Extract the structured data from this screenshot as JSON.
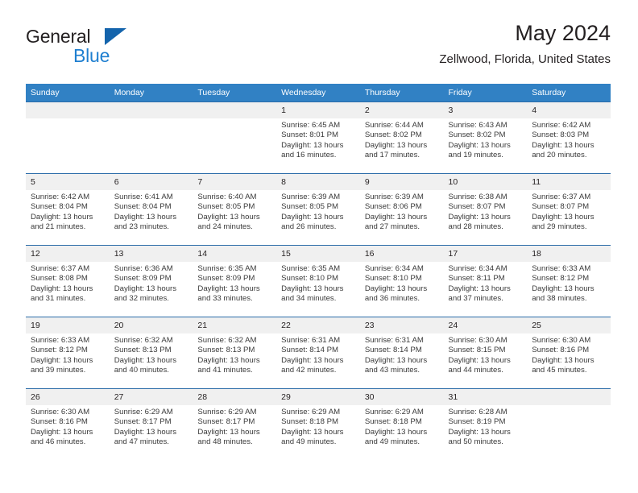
{
  "brand": {
    "name_part1": "General",
    "name_part2": "Blue",
    "logo_icon": "triangle-icon"
  },
  "header": {
    "title": "May 2024",
    "subtitle": "Zellwood, Florida, United States"
  },
  "colors": {
    "header_bar": "#3181c4",
    "daynum_band": "#f0f0f0",
    "row_border": "#2a6ba8",
    "brand_blue": "#1f7fd0",
    "logo_blue": "#1464ac",
    "text": "#231f20"
  },
  "weekday_headers": [
    "Sunday",
    "Monday",
    "Tuesday",
    "Wednesday",
    "Thursday",
    "Friday",
    "Saturday"
  ],
  "weeks": [
    [
      {
        "day": "",
        "sunrise": "",
        "sunset": "",
        "daylight1": "",
        "daylight2": ""
      },
      {
        "day": "",
        "sunrise": "",
        "sunset": "",
        "daylight1": "",
        "daylight2": ""
      },
      {
        "day": "",
        "sunrise": "",
        "sunset": "",
        "daylight1": "",
        "daylight2": ""
      },
      {
        "day": "1",
        "sunrise": "Sunrise: 6:45 AM",
        "sunset": "Sunset: 8:01 PM",
        "daylight1": "Daylight: 13 hours",
        "daylight2": "and 16 minutes."
      },
      {
        "day": "2",
        "sunrise": "Sunrise: 6:44 AM",
        "sunset": "Sunset: 8:02 PM",
        "daylight1": "Daylight: 13 hours",
        "daylight2": "and 17 minutes."
      },
      {
        "day": "3",
        "sunrise": "Sunrise: 6:43 AM",
        "sunset": "Sunset: 8:02 PM",
        "daylight1": "Daylight: 13 hours",
        "daylight2": "and 19 minutes."
      },
      {
        "day": "4",
        "sunrise": "Sunrise: 6:42 AM",
        "sunset": "Sunset: 8:03 PM",
        "daylight1": "Daylight: 13 hours",
        "daylight2": "and 20 minutes."
      }
    ],
    [
      {
        "day": "5",
        "sunrise": "Sunrise: 6:42 AM",
        "sunset": "Sunset: 8:04 PM",
        "daylight1": "Daylight: 13 hours",
        "daylight2": "and 21 minutes."
      },
      {
        "day": "6",
        "sunrise": "Sunrise: 6:41 AM",
        "sunset": "Sunset: 8:04 PM",
        "daylight1": "Daylight: 13 hours",
        "daylight2": "and 23 minutes."
      },
      {
        "day": "7",
        "sunrise": "Sunrise: 6:40 AM",
        "sunset": "Sunset: 8:05 PM",
        "daylight1": "Daylight: 13 hours",
        "daylight2": "and 24 minutes."
      },
      {
        "day": "8",
        "sunrise": "Sunrise: 6:39 AM",
        "sunset": "Sunset: 8:05 PM",
        "daylight1": "Daylight: 13 hours",
        "daylight2": "and 26 minutes."
      },
      {
        "day": "9",
        "sunrise": "Sunrise: 6:39 AM",
        "sunset": "Sunset: 8:06 PM",
        "daylight1": "Daylight: 13 hours",
        "daylight2": "and 27 minutes."
      },
      {
        "day": "10",
        "sunrise": "Sunrise: 6:38 AM",
        "sunset": "Sunset: 8:07 PM",
        "daylight1": "Daylight: 13 hours",
        "daylight2": "and 28 minutes."
      },
      {
        "day": "11",
        "sunrise": "Sunrise: 6:37 AM",
        "sunset": "Sunset: 8:07 PM",
        "daylight1": "Daylight: 13 hours",
        "daylight2": "and 29 minutes."
      }
    ],
    [
      {
        "day": "12",
        "sunrise": "Sunrise: 6:37 AM",
        "sunset": "Sunset: 8:08 PM",
        "daylight1": "Daylight: 13 hours",
        "daylight2": "and 31 minutes."
      },
      {
        "day": "13",
        "sunrise": "Sunrise: 6:36 AM",
        "sunset": "Sunset: 8:09 PM",
        "daylight1": "Daylight: 13 hours",
        "daylight2": "and 32 minutes."
      },
      {
        "day": "14",
        "sunrise": "Sunrise: 6:35 AM",
        "sunset": "Sunset: 8:09 PM",
        "daylight1": "Daylight: 13 hours",
        "daylight2": "and 33 minutes."
      },
      {
        "day": "15",
        "sunrise": "Sunrise: 6:35 AM",
        "sunset": "Sunset: 8:10 PM",
        "daylight1": "Daylight: 13 hours",
        "daylight2": "and 34 minutes."
      },
      {
        "day": "16",
        "sunrise": "Sunrise: 6:34 AM",
        "sunset": "Sunset: 8:10 PM",
        "daylight1": "Daylight: 13 hours",
        "daylight2": "and 36 minutes."
      },
      {
        "day": "17",
        "sunrise": "Sunrise: 6:34 AM",
        "sunset": "Sunset: 8:11 PM",
        "daylight1": "Daylight: 13 hours",
        "daylight2": "and 37 minutes."
      },
      {
        "day": "18",
        "sunrise": "Sunrise: 6:33 AM",
        "sunset": "Sunset: 8:12 PM",
        "daylight1": "Daylight: 13 hours",
        "daylight2": "and 38 minutes."
      }
    ],
    [
      {
        "day": "19",
        "sunrise": "Sunrise: 6:33 AM",
        "sunset": "Sunset: 8:12 PM",
        "daylight1": "Daylight: 13 hours",
        "daylight2": "and 39 minutes."
      },
      {
        "day": "20",
        "sunrise": "Sunrise: 6:32 AM",
        "sunset": "Sunset: 8:13 PM",
        "daylight1": "Daylight: 13 hours",
        "daylight2": "and 40 minutes."
      },
      {
        "day": "21",
        "sunrise": "Sunrise: 6:32 AM",
        "sunset": "Sunset: 8:13 PM",
        "daylight1": "Daylight: 13 hours",
        "daylight2": "and 41 minutes."
      },
      {
        "day": "22",
        "sunrise": "Sunrise: 6:31 AM",
        "sunset": "Sunset: 8:14 PM",
        "daylight1": "Daylight: 13 hours",
        "daylight2": "and 42 minutes."
      },
      {
        "day": "23",
        "sunrise": "Sunrise: 6:31 AM",
        "sunset": "Sunset: 8:14 PM",
        "daylight1": "Daylight: 13 hours",
        "daylight2": "and 43 minutes."
      },
      {
        "day": "24",
        "sunrise": "Sunrise: 6:30 AM",
        "sunset": "Sunset: 8:15 PM",
        "daylight1": "Daylight: 13 hours",
        "daylight2": "and 44 minutes."
      },
      {
        "day": "25",
        "sunrise": "Sunrise: 6:30 AM",
        "sunset": "Sunset: 8:16 PM",
        "daylight1": "Daylight: 13 hours",
        "daylight2": "and 45 minutes."
      }
    ],
    [
      {
        "day": "26",
        "sunrise": "Sunrise: 6:30 AM",
        "sunset": "Sunset: 8:16 PM",
        "daylight1": "Daylight: 13 hours",
        "daylight2": "and 46 minutes."
      },
      {
        "day": "27",
        "sunrise": "Sunrise: 6:29 AM",
        "sunset": "Sunset: 8:17 PM",
        "daylight1": "Daylight: 13 hours",
        "daylight2": "and 47 minutes."
      },
      {
        "day": "28",
        "sunrise": "Sunrise: 6:29 AM",
        "sunset": "Sunset: 8:17 PM",
        "daylight1": "Daylight: 13 hours",
        "daylight2": "and 48 minutes."
      },
      {
        "day": "29",
        "sunrise": "Sunrise: 6:29 AM",
        "sunset": "Sunset: 8:18 PM",
        "daylight1": "Daylight: 13 hours",
        "daylight2": "and 49 minutes."
      },
      {
        "day": "30",
        "sunrise": "Sunrise: 6:29 AM",
        "sunset": "Sunset: 8:18 PM",
        "daylight1": "Daylight: 13 hours",
        "daylight2": "and 49 minutes."
      },
      {
        "day": "31",
        "sunrise": "Sunrise: 6:28 AM",
        "sunset": "Sunset: 8:19 PM",
        "daylight1": "Daylight: 13 hours",
        "daylight2": "and 50 minutes."
      },
      {
        "day": "",
        "sunrise": "",
        "sunset": "",
        "daylight1": "",
        "daylight2": ""
      }
    ]
  ]
}
